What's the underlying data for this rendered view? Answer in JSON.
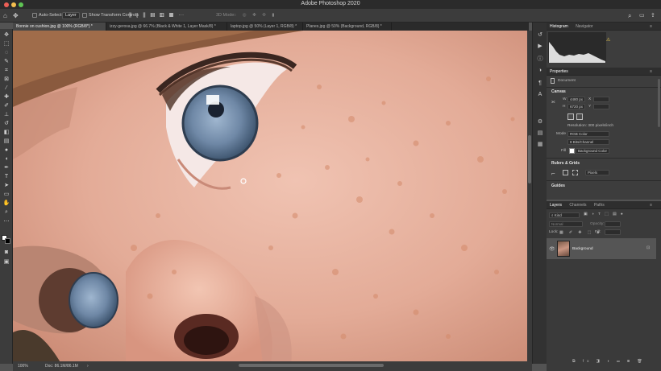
{
  "app": {
    "title": "Adobe Photoshop 2020"
  },
  "options_bar": {
    "auto_select_label": "Auto-Select:",
    "layer_select_value": "Layer",
    "transform_controls_label": "Show Transform Controls",
    "mode_3d_label": "3D Mode:"
  },
  "tabs": [
    {
      "label": "Bonnie on cushion.jpg @ 100% (RGB/8*) *"
    },
    {
      "label": "izzy-gerosa.jpg @ 66.7% (Black & White 1, Layer Mask/8) *"
    },
    {
      "label": "laptop.jpg @ 50% (Layer 1, RGB/8) *"
    },
    {
      "label": "Planes.jpg @ 50% (Background, RGB/8) *"
    }
  ],
  "status": {
    "zoom": "100%",
    "doc_info": "Doc: 86.1M/86.1M"
  },
  "histogram_panel": {
    "tabs": [
      "Histogram",
      "Navigator"
    ]
  },
  "properties_panel": {
    "title": "Properties",
    "doc_label": "Document",
    "canvas_section": "Canvas",
    "w_label": "W",
    "w_value": "4480 px",
    "h_label": "H",
    "h_value": "6720 px",
    "x_label": "X",
    "y_label": "Y",
    "resolution": "Resolution: 300 pixels/inch",
    "mode_label": "Mode",
    "mode_value": "RGB Color",
    "depth_value": "8 Bits/Channel",
    "fill_label": "Fill",
    "fill_value": "Background Color",
    "rulers_section": "Rulers & Grids",
    "units_value": "Pixels",
    "guides_section": "Guides"
  },
  "layers_panel": {
    "tabs": [
      "Layers",
      "Channels",
      "Paths"
    ],
    "kind_placeholder": "Kind",
    "blend_mode": "Normal",
    "opacity_label": "Opacity:",
    "lock_label": "Lock:",
    "fill_label": "Fill:",
    "layer_name": "Background"
  },
  "colors": {
    "app_bg": "#535353",
    "panel_bg": "#3d3d3d",
    "selected_layer": "#555555",
    "skin": "#d9a08c",
    "iris": "#6f88a6"
  }
}
